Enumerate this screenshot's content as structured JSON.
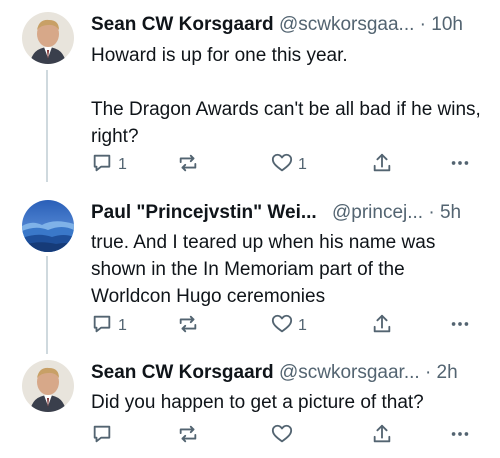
{
  "tweets": [
    {
      "name": "Sean CW Korsgaard",
      "handle": "@scwkorsgaa...",
      "sep": "·",
      "time": "10h",
      "text": "Howard is up for one this year.\n\nThe Dragon Awards can't be all bad if he wins, right?",
      "reply_count": "1",
      "like_count": "1",
      "avatar": "man-portrait"
    },
    {
      "name": "Paul \"Princejvstin\" Wei...",
      "handle": "@princej...",
      "sep": "·",
      "time": "5h",
      "text": "true. And I teared up when his name was shown in the In Memoriam part of the Worldcon Hugo ceremonies",
      "reply_count": "1",
      "like_count": "1",
      "avatar": "blue-mountains"
    },
    {
      "name": "Sean CW Korsgaard",
      "handle": "@scwkorsgaar...",
      "sep": "·",
      "time": "2h",
      "text": "Did you happen to get a picture of that?",
      "reply_count": "",
      "like_count": "",
      "avatar": "man-portrait"
    }
  ],
  "icons": {
    "reply": "reply-icon",
    "retweet": "retweet-icon",
    "like": "heart-icon",
    "share": "share-icon",
    "more": "more-icon"
  },
  "colors": {
    "icon": "#536471",
    "line": "#cfd9de",
    "text": "#0f1419"
  }
}
